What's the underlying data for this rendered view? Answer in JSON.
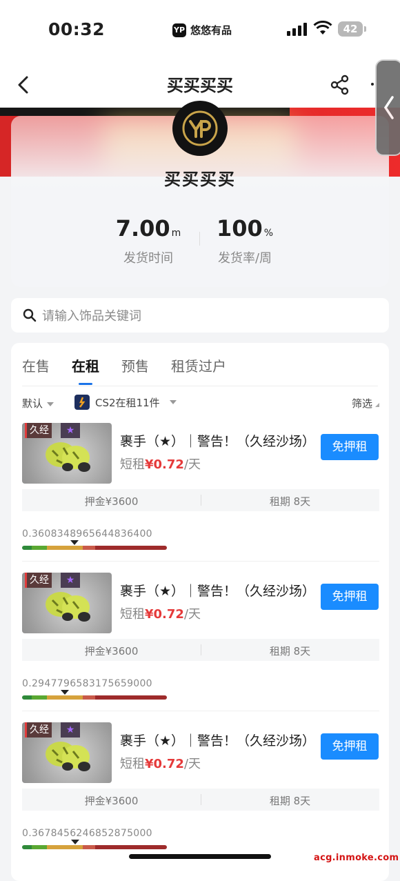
{
  "status_bar": {
    "time": "00:32",
    "carrier": "悠悠有品",
    "carrier_logo": "YP",
    "battery": "42"
  },
  "nav": {
    "title": "买买买买"
  },
  "shop": {
    "name": "买买买买",
    "stats": [
      {
        "value": "7.00",
        "unit": "m",
        "label": "发货时间"
      },
      {
        "value": "100",
        "unit": "%",
        "label": "发货率/周"
      }
    ]
  },
  "search": {
    "placeholder": "请输入饰品关键词"
  },
  "tabs": [
    "在售",
    "在租",
    "预售",
    "租赁过户"
  ],
  "filters": {
    "sort": "默认",
    "game": "CS2在租11件",
    "filter": "筛选"
  },
  "items": [
    {
      "wear_badge": "久经",
      "star_badge": "★",
      "title": "裹手（★）｜警告！（久经沙场）",
      "price_prefix": "短租",
      "price": "¥0.72",
      "price_suffix": "/天",
      "rent_label": "免押租",
      "deposit": "押金¥3600",
      "term": "租期 8天",
      "float": "0.3608348965644836400",
      "float_value": 0.3608
    },
    {
      "wear_badge": "久经",
      "star_badge": "★",
      "title": "裹手（★）｜警告！（久经沙场）",
      "price_prefix": "短租",
      "price": "¥0.72",
      "price_suffix": "/天",
      "rent_label": "免押租",
      "deposit": "押金¥3600",
      "term": "租期 8天",
      "float": "0.2947796583175659000",
      "float_value": 0.2948
    },
    {
      "wear_badge": "久经",
      "star_badge": "★",
      "title": "裹手（★）｜警告！（久经沙场）",
      "price_prefix": "短租",
      "price": "¥0.72",
      "price_suffix": "/天",
      "rent_label": "免押租",
      "deposit": "押金¥3600",
      "term": "租期 8天",
      "float": "0.3678456246852875000",
      "float_value": 0.3678
    }
  ],
  "watermark": "acg.inmoke.com",
  "colors": {
    "accent": "#1a8cff",
    "price": "#e53a3a",
    "banner": "#d62626"
  },
  "icons": [
    "back-icon",
    "share-icon",
    "search-icon",
    "cs2-game-icon",
    "shop-logo-icon"
  ]
}
